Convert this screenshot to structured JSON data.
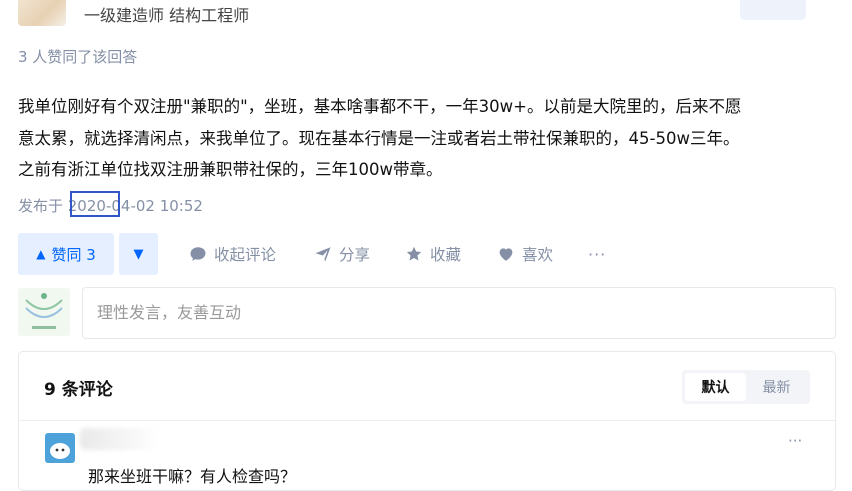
{
  "author": {
    "title": "一级建造师 结构工程师"
  },
  "upvote_summary": "3 人赞同了该回答",
  "answer": {
    "lines": [
      "我单位刚好有个双注册\"兼职的\"，坐班，基本啥事都不干，一年30w+。以前是大院里的，后来不愿",
      "意太累，就选择清闲点，来我单位了。现在基本行情是一注或者岩土带社保兼职的，45-50w三年。",
      "之前有浙江单位找双注册兼职带社保的，三年100w带章。"
    ],
    "published": "发布于 2020-04-02 10:52"
  },
  "actions": {
    "upvote": "赞同 3",
    "comments": "收起评论",
    "share": "分享",
    "favorite": "收藏",
    "like": "喜欢",
    "more": "···"
  },
  "composer": {
    "placeholder": "理性发言，友善互动"
  },
  "comments": {
    "count_label": "9 条评论",
    "sort_default": "默认",
    "sort_latest": "最新",
    "first": {
      "text": "那来坐班干嘛？有人检查吗？",
      "more": "···"
    }
  },
  "colors": {
    "accent": "#0066ff",
    "accent_bg": "#e5efff",
    "muted": "#8590a6",
    "highlight": "#2f57c7"
  }
}
